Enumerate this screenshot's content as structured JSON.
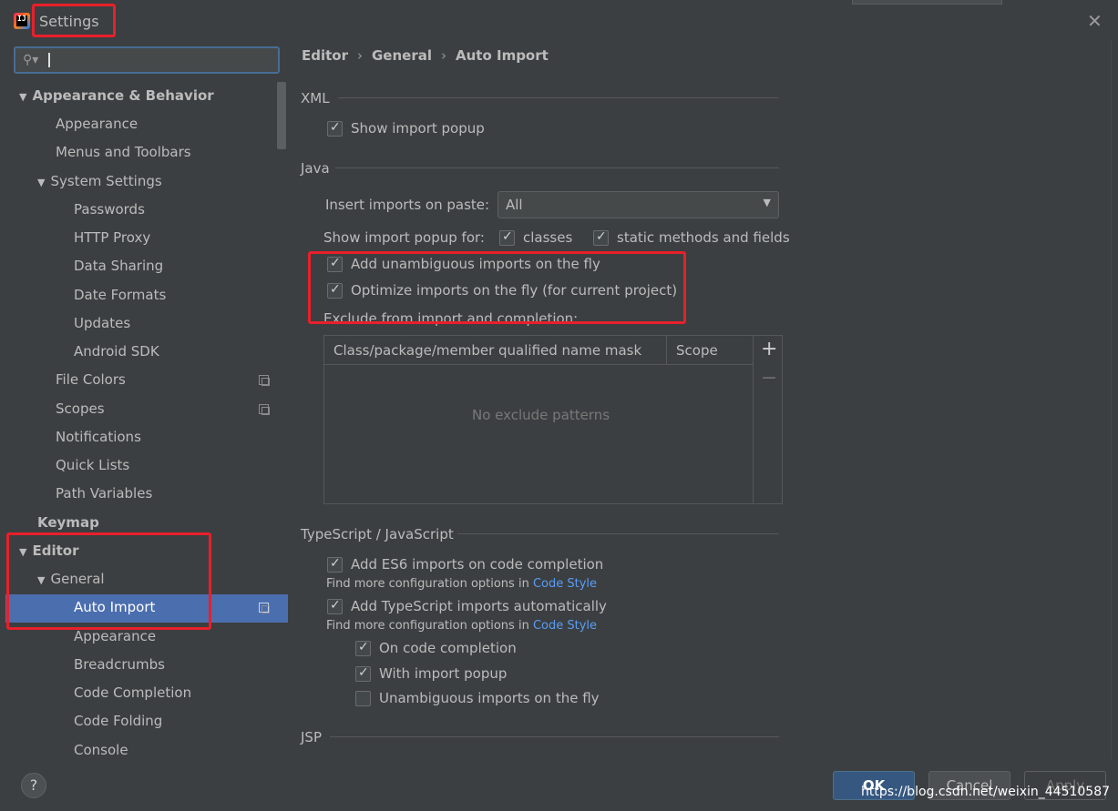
{
  "window": {
    "title": "Settings",
    "app_icon_text": "IJ",
    "icon": "intellij-icon"
  },
  "search": {
    "value": "",
    "icon": "search-icon"
  },
  "tree": [
    {
      "label": "Appearance & Behavior",
      "expanded": true
    },
    {
      "label": "Appearance"
    },
    {
      "label": "Menus and Toolbars"
    },
    {
      "label": "System Settings",
      "expanded": true
    },
    {
      "label": "Passwords"
    },
    {
      "label": "HTTP Proxy"
    },
    {
      "label": "Data Sharing"
    },
    {
      "label": "Date Formats"
    },
    {
      "label": "Updates"
    },
    {
      "label": "Android SDK"
    },
    {
      "label": "File Colors",
      "icon": "copy-icon"
    },
    {
      "label": "Scopes",
      "icon": "copy-icon"
    },
    {
      "label": "Notifications"
    },
    {
      "label": "Quick Lists"
    },
    {
      "label": "Path Variables"
    },
    {
      "label": "Keymap"
    },
    {
      "label": "Editor",
      "expanded": true
    },
    {
      "label": "General",
      "expanded": true
    },
    {
      "label": "Auto Import",
      "selected": true,
      "icon": "copy-icon"
    },
    {
      "label": "Appearance"
    },
    {
      "label": "Breadcrumbs"
    },
    {
      "label": "Code Completion"
    },
    {
      "label": "Code Folding"
    },
    {
      "label": "Console"
    }
  ],
  "breadcrumb": [
    "Editor",
    "General",
    "Auto Import"
  ],
  "breadcrumb_sep": "›",
  "xml": {
    "header": "XML",
    "show_import_popup": {
      "label": "Show import popup",
      "checked": true
    }
  },
  "java": {
    "header": "Java",
    "insert_imports_label": "Insert imports on paste:",
    "insert_imports_value": "All",
    "show_popup_for_label": "Show import popup for:",
    "classes": {
      "label": "classes",
      "checked": true
    },
    "static_methods": {
      "label": "static methods and fields",
      "checked": true
    },
    "add_unambiguous": {
      "label": "Add unambiguous imports on the fly",
      "checked": true
    },
    "optimize_imports": {
      "label": "Optimize imports on the fly (for current project)",
      "checked": true
    },
    "exclude_label": "Exclude from import and completion:",
    "table": {
      "columns": [
        "Class/package/member qualified name mask",
        "Scope"
      ],
      "empty_text": "No exclude patterns",
      "add_symbol": "+",
      "remove_symbol": "−"
    }
  },
  "ts": {
    "header": "TypeScript / JavaScript",
    "es6": {
      "label": "Add ES6 imports on code completion",
      "checked": true
    },
    "hint_text": "Find more configuration options in",
    "hint_link": "Code Style",
    "ts_auto": {
      "label": "Add TypeScript imports automatically",
      "checked": true
    },
    "on_completion": {
      "label": "On code completion",
      "checked": true
    },
    "with_popup": {
      "label": "With import popup",
      "checked": true
    },
    "unambiguous": {
      "label": "Unambiguous imports on the fly",
      "checked": false
    }
  },
  "jsp": {
    "header": "JSP"
  },
  "footer": {
    "help": "?",
    "ok": "OK",
    "cancel": "Cancel",
    "apply": "Apply"
  },
  "watermark": "https://blog.csdn.net/weixin_44510587",
  "colors": {
    "background": "#3c3f41",
    "selection": "#4b6eaf",
    "link": "#589df6",
    "highlight": "#e8202a"
  }
}
